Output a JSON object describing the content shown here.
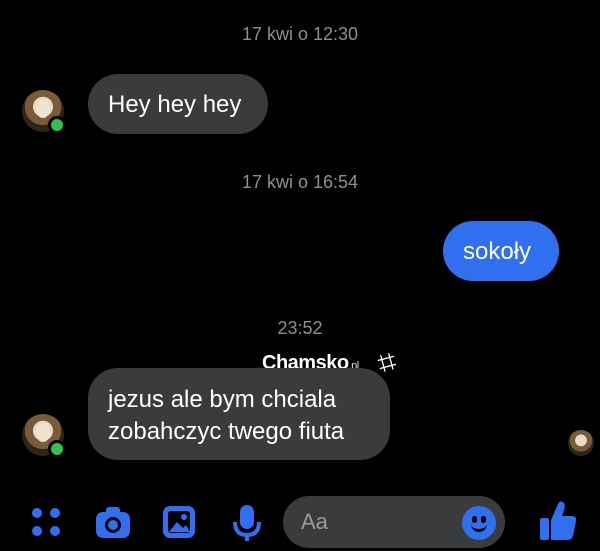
{
  "conversation": {
    "messages": [
      {
        "timestamp": "17 kwi o 12:30",
        "from": "contact",
        "text": "Hey hey hey"
      },
      {
        "timestamp": "17 kwi o 16:54",
        "from": "me",
        "text": "sokoły"
      },
      {
        "timestamp": "23:52",
        "from": "contact",
        "line1": "jezus ale bym chciala",
        "line2": "zobahczyc twego fiuta"
      }
    ]
  },
  "watermark": {
    "brand": "Chamsko",
    "tld": ".pl",
    "symbol": "⌗"
  },
  "composer": {
    "placeholder": "Aa"
  },
  "icons": {
    "apps": "apps-icon",
    "camera": "camera-icon",
    "gallery": "image-icon",
    "mic": "microphone-icon",
    "emoji": "emoji-icon",
    "like": "thumbs-up-icon"
  },
  "colors": {
    "background": "#000000",
    "incoming_bubble": "#3a3b3d",
    "outgoing_bubble": "#2f6ff0",
    "accent": "#2f6ff0",
    "online": "#31c24d",
    "timestamp": "#8f8f8f"
  }
}
